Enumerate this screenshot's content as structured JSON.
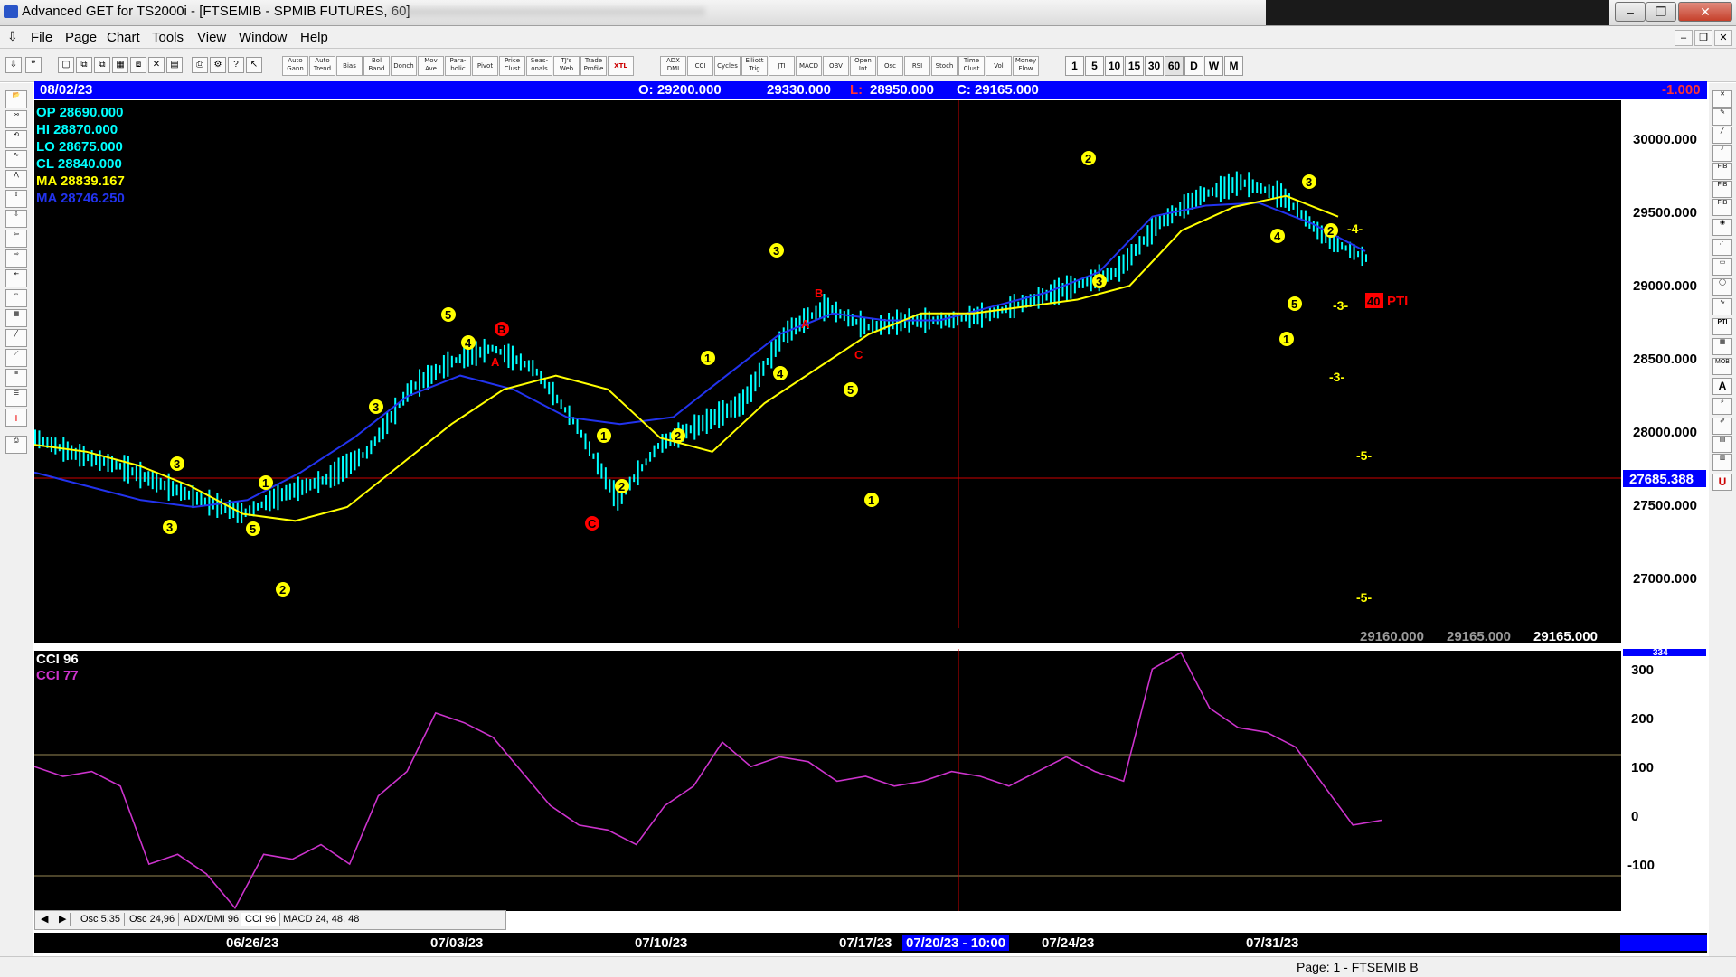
{
  "window": {
    "title": "Advanced GET for TS2000i - [FTSEMIB - SPMIB FUTURES, 60]"
  },
  "menu": [
    "File",
    "Page",
    "Chart",
    "Tools",
    "View",
    "Window",
    "Help"
  ],
  "toolbar": {
    "study_buttons": [
      "Auto Gann",
      "Auto Trend",
      "Bias",
      "Bol Band",
      "Donch",
      "Mov Ave",
      "Para- bolic",
      "Pivot",
      "Price Clust",
      "Seas- onals",
      "TJ's Web",
      "Trade Profile",
      "XTL",
      "ADX DMI",
      "CCI",
      "Cycles",
      "Elliott Trig",
      "JTI",
      "MACD",
      "OBV",
      "Open Int",
      "Osc",
      "RSI",
      "Stoch",
      "Time Clust",
      "Vol",
      "Money Flow"
    ],
    "timeframes": [
      "1",
      "5",
      "10",
      "15",
      "30",
      "60",
      "D",
      "W",
      "M"
    ]
  },
  "header_strip": {
    "date": "08/02/23",
    "open": "O: 29200.000",
    "high": "29330.000",
    "low_label": "L:",
    "low": "28950.000",
    "close": "C: 29165.000",
    "change": "-1.000"
  },
  "readout": {
    "op": "OP  28690.000",
    "hi": "HI   28870.000",
    "lo": "LO  28675.000",
    "cl": "CL  28840.000",
    "ma1": "MA  28839.167",
    "ma2": "MA  28746.250"
  },
  "price_axis": {
    "labels": [
      "30000.000",
      "29500.000",
      "29000.000",
      "28500.000",
      "28000.000",
      "27500.000",
      "27000.000"
    ],
    "crosshair_price": "27685.388",
    "bottom_values": [
      "29160.000",
      "29165.000",
      "29165.000"
    ]
  },
  "cci_panel": {
    "label1": "CCI 96",
    "label2": "CCI  77",
    "axis": [
      "300",
      "200",
      "100",
      "0",
      "-100"
    ],
    "top_value": "334"
  },
  "annotations": {
    "pti_value": "40",
    "pti_label": "PTI",
    "minus_labels": [
      "-3-",
      "-3-",
      "-4-",
      "-5-",
      "-5-"
    ],
    "wave_circles": [
      "3",
      "5",
      "4",
      "3",
      "1",
      "2",
      "3",
      "5",
      "1",
      "2",
      "1",
      "2",
      "3",
      "4",
      "5",
      "1",
      "2",
      "3",
      "4",
      "5",
      "2",
      "1",
      "3"
    ],
    "wave_letters": [
      "A",
      "B",
      "C",
      "A",
      "B",
      "C"
    ]
  },
  "tabs": [
    "Osc 5,35",
    "Osc 24,96",
    "ADX/DMI 96",
    "CCI 96",
    "MACD 24, 48, 48"
  ],
  "dates": [
    "06/26/23",
    "07/03/23",
    "07/10/23",
    "07/17/23",
    "07/20/23 - 10:00",
    "07/24/23",
    "07/31/23"
  ],
  "status": "Page: 1 - FTSEMIB B",
  "colors": {
    "background": "#000000",
    "price_bars": "#00ffff",
    "ma_fast": "#ffff00",
    "ma_slow": "#0000ff",
    "cci": "#cc33cc",
    "wave_marks": "#ffff00",
    "abc_marks": "#ff0000",
    "header": "#0000ff"
  },
  "chart_data": {
    "type": "line",
    "x_dates": [
      "06/26/23",
      "07/03/23",
      "07/10/23",
      "07/17/23",
      "07/24/23",
      "07/31/23"
    ],
    "ylim": [
      26600,
      30300
    ],
    "series": [
      {
        "values": [
          27950,
          27830,
          27750,
          27620,
          27500,
          27400,
          27550,
          27650,
          27850,
          28300,
          28500,
          28600,
          28450,
          28050,
          27500,
          27900,
          28050,
          28200,
          28700,
          28900,
          28750,
          28800,
          28800,
          28850,
          28950,
          29050,
          29150,
          29500,
          29700,
          29800,
          29700,
          29400,
          29250
        ]
      },
      {
        "values": [
          27700,
          27600,
          27500,
          27450,
          27500,
          27700,
          27950,
          28250,
          28400,
          28300,
          28100,
          28050,
          28100,
          28400,
          28700,
          28850,
          28800,
          28800,
          28900,
          29000,
          29150,
          29550,
          29630,
          29650,
          29500,
          29300
        ]
      },
      {
        "values": [
          27900,
          27850,
          27750,
          27600,
          27400,
          27350,
          27450,
          27750,
          28050,
          28300,
          28400,
          28300,
          27950,
          27850,
          28200,
          28450,
          28700,
          28850,
          28850,
          28900,
          28950,
          29050,
          29450,
          29620,
          29700,
          29550
        ]
      }
    ],
    "cci": {
      "ylim": [
        -200,
        334
      ],
      "values": [
        100,
        80,
        90,
        60,
        -100,
        -80,
        -120,
        -190,
        -80,
        -90,
        -60,
        -100,
        40,
        90,
        210,
        190,
        160,
        90,
        20,
        -20,
        -30,
        -60,
        20,
        60,
        150,
        100,
        120,
        110,
        70,
        80,
        60,
        70,
        90,
        80,
        60,
        90,
        120,
        90,
        70,
        300,
        334,
        220,
        180,
        170,
        140,
        60,
        -20,
        -10
      ]
    }
  }
}
